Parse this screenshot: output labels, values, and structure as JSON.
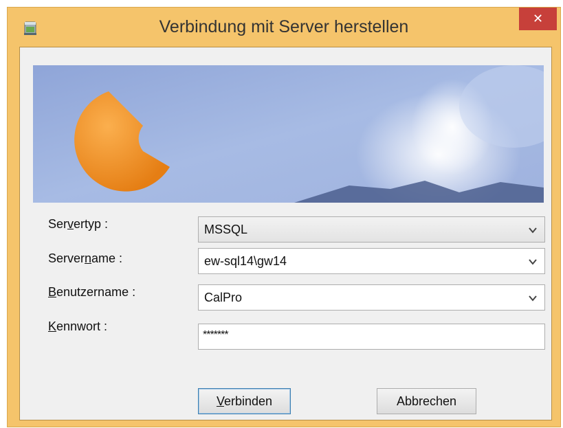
{
  "window": {
    "title": "Verbindung mit Server herstellen",
    "close_label": "✕"
  },
  "form": {
    "servertyp": {
      "pre": "Ser",
      "acc": "v",
      "post": "ertyp :",
      "value": "MSSQL"
    },
    "servername": {
      "pre": "Server",
      "acc": "n",
      "post": "ame :",
      "value": "ew-sql14\\gw14"
    },
    "benutzername": {
      "pre": "",
      "acc": "B",
      "post": "enutzername :",
      "value": "CalPro"
    },
    "kennwort": {
      "pre": "",
      "acc": "K",
      "post": "ennwort :",
      "value": "*******"
    }
  },
  "buttons": {
    "connect": {
      "acc": "V",
      "rest": "erbinden"
    },
    "cancel": "Abbrechen"
  },
  "colors": {
    "frame": "#F5C46B",
    "close": "#C7403A",
    "logo": "#EE8A1C"
  }
}
